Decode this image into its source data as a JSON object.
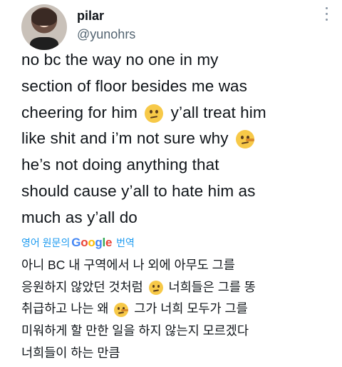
{
  "author": {
    "display_name": "pilar",
    "handle": "@yunohrs"
  },
  "icons": {
    "more": "more-icon",
    "emoji_1": "confused-face-emoji",
    "emoji_2": "lying-face-emoji"
  },
  "tweet": {
    "lines": [
      "no bc the way no one in my",
      "section of floor besides me was",
      "cheering for him",
      "y’all treat him",
      "like shit and i’m not sure why",
      "he’s not doing anything that",
      "should cause y’all to hate him as",
      "much as y’all do"
    ]
  },
  "translate": {
    "prefix": "영어 원문의",
    "google": [
      "G",
      "o",
      "o",
      "g",
      "l",
      "e"
    ],
    "suffix": "번역"
  },
  "translation": {
    "lines": [
      "아니 BC 내 구역에서 나 외에 아무도 그를",
      "응원하지 않았던 것처럼",
      "너희들은 그를 똥",
      "취급하고 나는 왜",
      "그가 너희 모두가 그를",
      "미워하게 할 만한 일을 하지 않는지 모르겠다",
      "너희들이 하는 만큼"
    ]
  }
}
